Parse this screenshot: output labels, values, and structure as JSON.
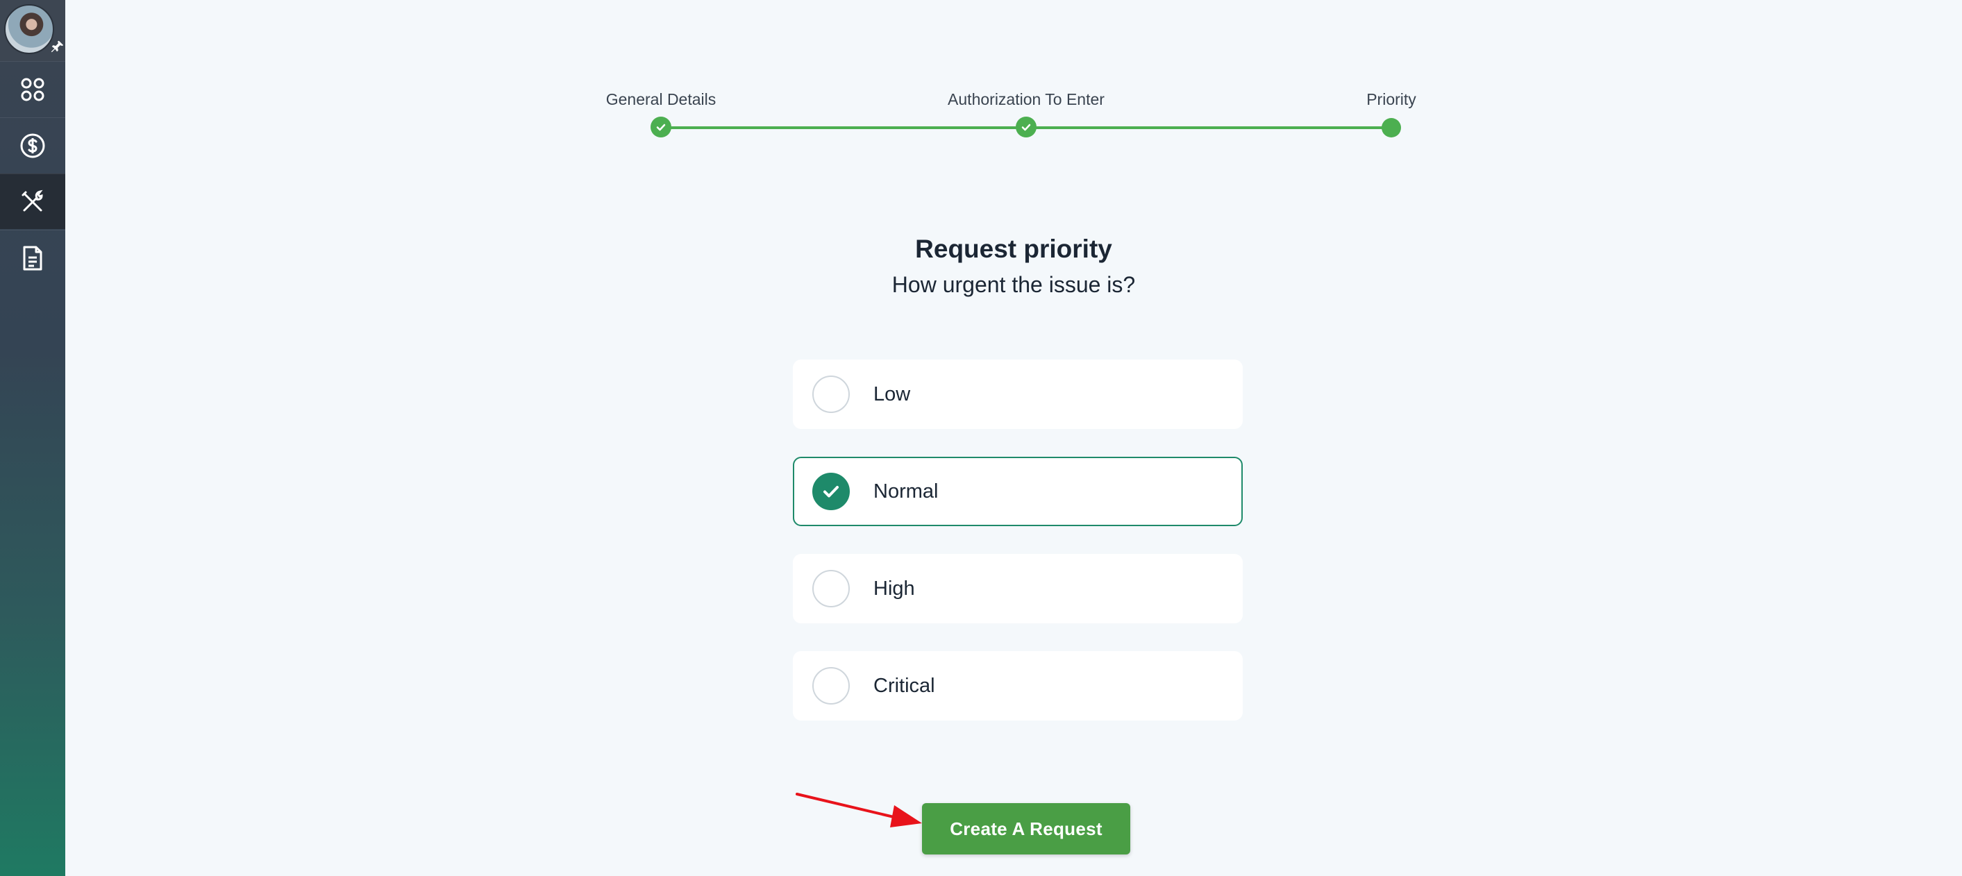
{
  "sidebar": {
    "items": [
      {
        "icon": "apps-grid-icon"
      },
      {
        "icon": "dollar-circle-icon"
      },
      {
        "icon": "tools-icon",
        "active": true
      },
      {
        "icon": "document-icon"
      }
    ]
  },
  "stepper": {
    "steps": [
      {
        "label": "General Details",
        "status": "complete"
      },
      {
        "label": "Authorization To Enter",
        "status": "complete"
      },
      {
        "label": "Priority",
        "status": "current"
      }
    ]
  },
  "main": {
    "title": "Request priority",
    "subtitle": "How urgent the issue is?",
    "options": [
      {
        "label": "Low",
        "selected": false
      },
      {
        "label": "Normal",
        "selected": true
      },
      {
        "label": "High",
        "selected": false
      },
      {
        "label": "Critical",
        "selected": false
      }
    ],
    "submit_label": "Create A Request"
  },
  "colors": {
    "accent_green": "#4caf50",
    "selected_teal": "#1e8a6a",
    "button_green": "#4a9e45",
    "annotation_arrow": "#e8131b"
  }
}
